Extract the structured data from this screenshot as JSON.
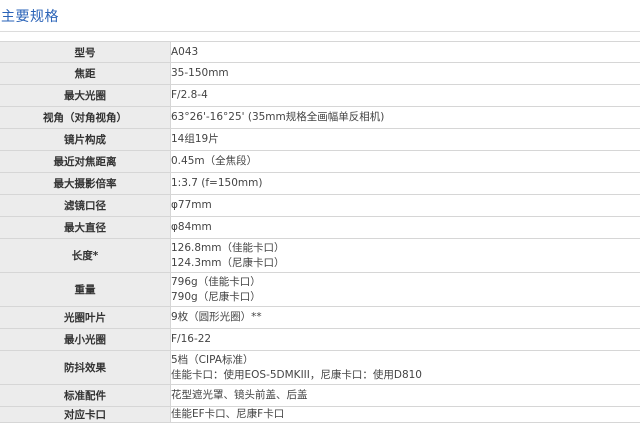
{
  "section_title": "主要规格",
  "specs": [
    {
      "label": "型号",
      "lines": [
        "A043"
      ]
    },
    {
      "label": "焦距",
      "lines": [
        "35-150mm"
      ]
    },
    {
      "label": "最大光圈",
      "lines": [
        "F/2.8-4"
      ]
    },
    {
      "label": "视角（对角视角）",
      "lines": [
        "63°26'-16°25' (35mm规格全画幅单反相机)"
      ]
    },
    {
      "label": "镜片构成",
      "lines": [
        "14组19片"
      ]
    },
    {
      "label": "最近对焦距离",
      "lines": [
        "0.45m（全焦段）"
      ]
    },
    {
      "label": "最大摄影倍率",
      "lines": [
        "1:3.7 (f=150mm)"
      ]
    },
    {
      "label": "滤镜口径",
      "lines": [
        "φ77mm"
      ]
    },
    {
      "label": "最大直径",
      "lines": [
        "φ84mm"
      ]
    },
    {
      "label": "长度*",
      "lines": [
        "126.8mm（佳能卡口）",
        "124.3mm（尼康卡口）"
      ]
    },
    {
      "label": "重量",
      "lines": [
        "796g（佳能卡口）",
        "790g（尼康卡口）"
      ]
    },
    {
      "label": "光圈叶片",
      "lines": [
        "9枚（圆形光圈）**"
      ]
    },
    {
      "label": "最小光圈",
      "lines": [
        "F/16-22"
      ]
    },
    {
      "label": "防抖效果",
      "lines": [
        "5档（CIPA标准）",
        "佳能卡口：使用EOS-5DMKIII，尼康卡口：使用D810"
      ]
    },
    {
      "label": "标准配件",
      "lines": [
        "花型遮光罩、镜头前盖、后盖"
      ]
    },
    {
      "label": "对应卡口",
      "lines": [
        "佳能EF卡口、尼康F卡口"
      ]
    }
  ]
}
